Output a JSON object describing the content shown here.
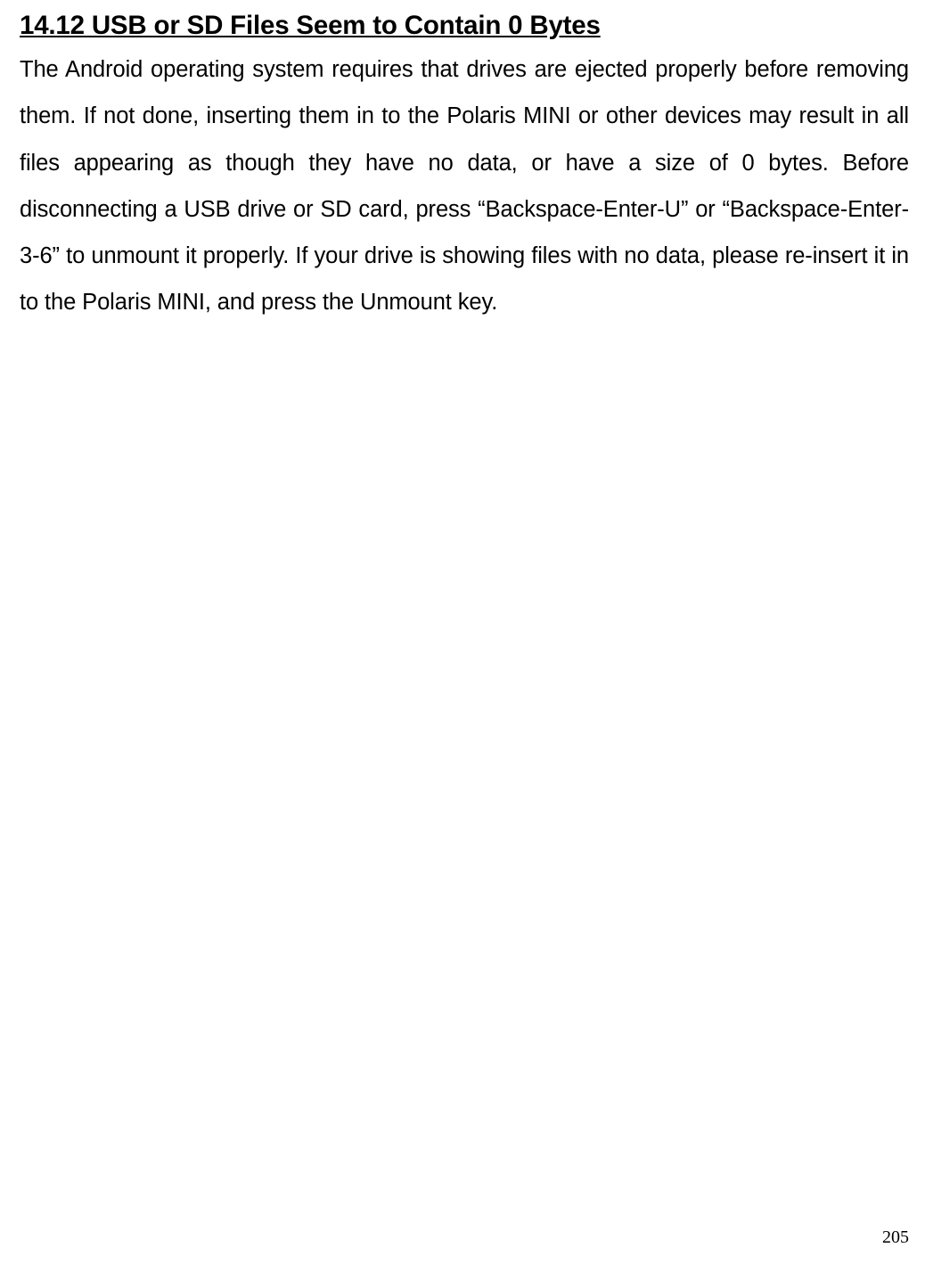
{
  "heading": "14.12 USB or SD Files Seem to Contain 0 Bytes",
  "body": "The Android operating system requires that drives are ejected properly before removing them. If not done, inserting them in to the Polaris MINI or other devices may result in all files appearing as though they have no data, or have a size of 0 bytes. Before disconnecting a USB drive or SD card, press “Backspace-Enter-U” or “Backspace-Enter-3-6” to unmount it properly. If your drive is showing files with no data, please re-insert it in to the Polaris MINI, and press the Unmount key.",
  "pageNumber": "205"
}
